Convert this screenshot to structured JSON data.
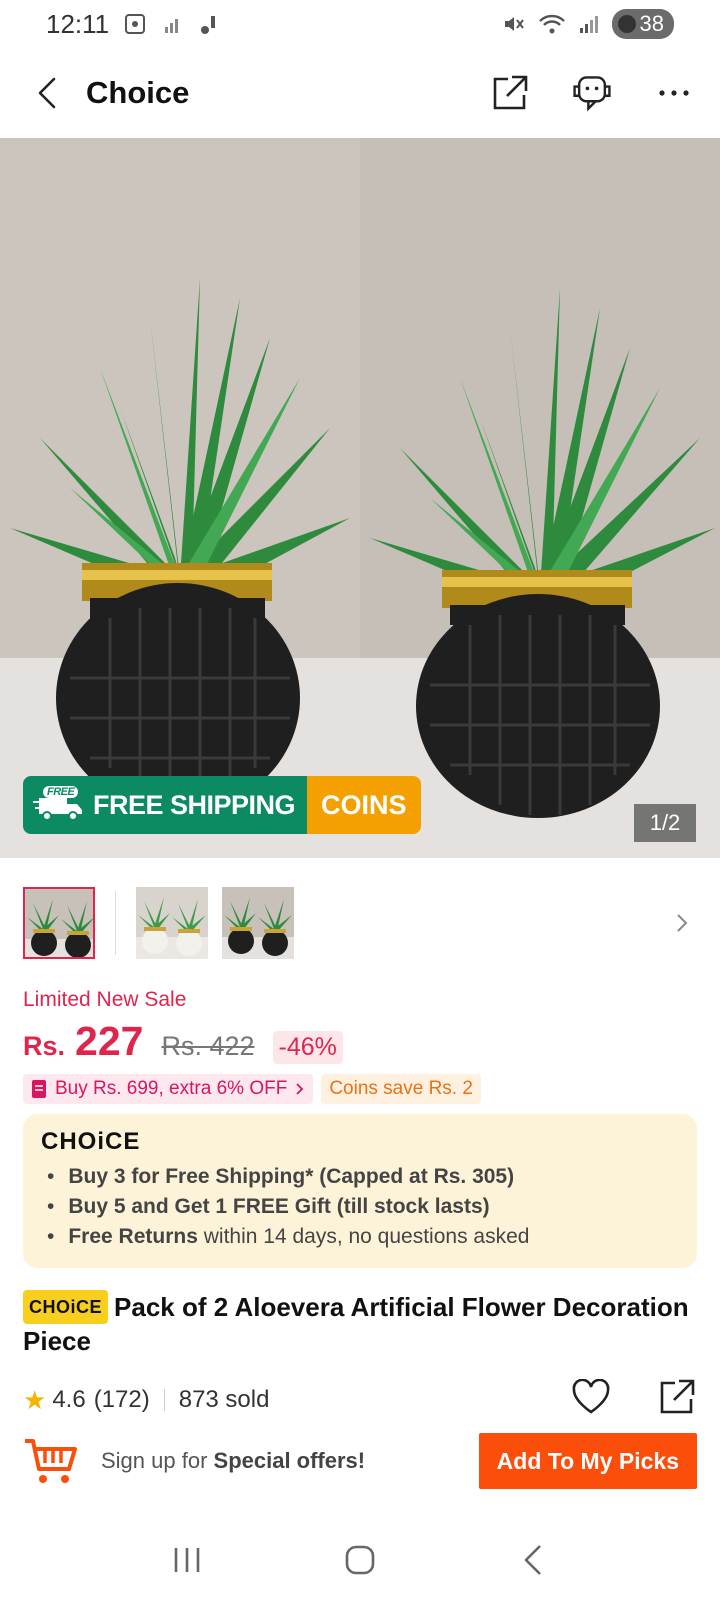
{
  "status_bar": {
    "time": "12:11",
    "battery": "38"
  },
  "header": {
    "title": "Choice"
  },
  "hero": {
    "ship_free_tag": "FREE",
    "ship_text": "FREE SHIPPING",
    "coins_text": "COINS",
    "counter": "1/2"
  },
  "price": {
    "sale_label": "Limited New Sale",
    "currency": "Rs.",
    "value": "227",
    "original": "Rs. 422",
    "discount": "-46%"
  },
  "promos": {
    "buy_offer": "Buy Rs. 699, extra 6% OFF",
    "coins_save": "Coins save Rs. 2"
  },
  "choice": {
    "logo": "CHOiCE",
    "benefits": [
      {
        "bold": "Buy 3 for  Free Shipping* (Capped at Rs. 305)",
        "rest": ""
      },
      {
        "bold": "Buy 5 and Get 1 FREE Gift (till stock lasts)",
        "rest": ""
      },
      {
        "bold": "Free Returns",
        "rest": " within 14 days, no questions asked"
      }
    ]
  },
  "product": {
    "badge": "CHOiCE",
    "title": "Pack of 2 Aloevera Artificial Flower Decoration Piece",
    "rating": "4.6",
    "reviews": "(172)",
    "sold": "873 sold"
  },
  "bottom": {
    "signup_prefix": "Sign up for ",
    "signup_strong": "Special offers!",
    "cta": "Add To My Picks"
  },
  "colors": {
    "accent": "#e0254d",
    "cta": "#fb4e0b",
    "ship_green": "#0b8a64",
    "coins_orange": "#f4a000",
    "choice_bg": "#fdf3d8"
  },
  "icons": [
    "back-icon",
    "share-icon",
    "support-bot-icon",
    "more-icon",
    "chevron-right-icon",
    "star-icon",
    "heart-icon",
    "cart-icon",
    "nav-recents-icon",
    "nav-home-icon",
    "nav-back-icon"
  ]
}
